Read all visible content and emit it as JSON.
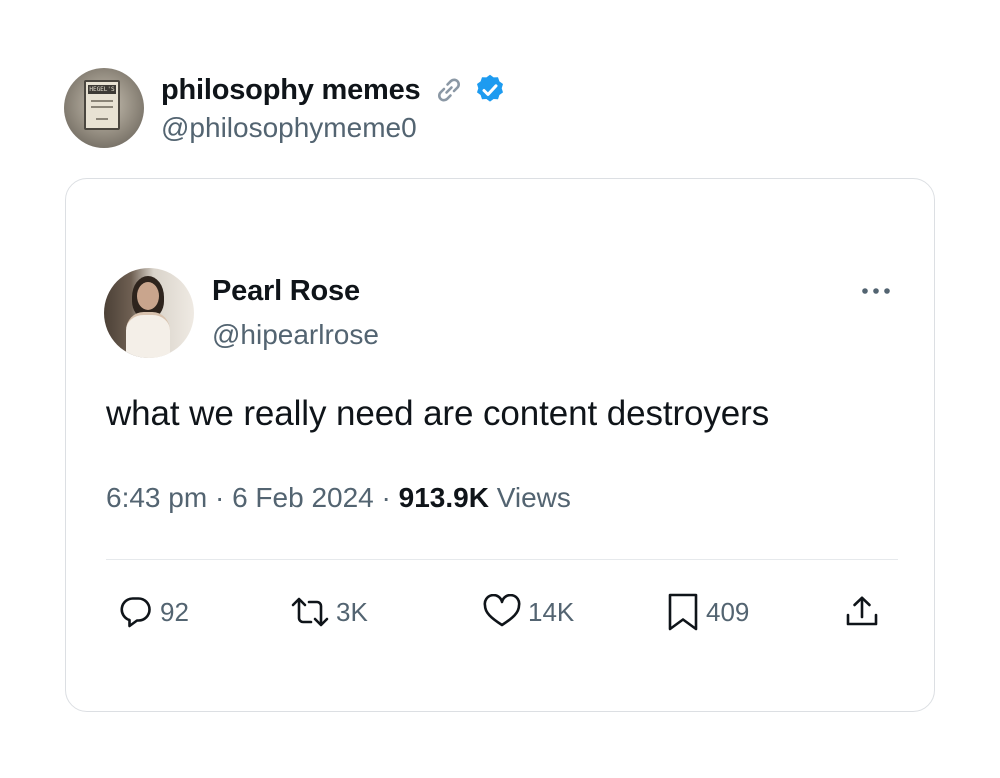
{
  "outer": {
    "display_name": "philosophy memes",
    "handle": "@philosophymeme0",
    "avatar_book_title": "HEGEL'S"
  },
  "tweet": {
    "author_name": "Pearl Rose",
    "author_handle": "@hipearlrose",
    "text": "what we really need are content destroyers",
    "time": "6:43 pm",
    "separator": "·",
    "date": "6 Feb 2024",
    "views_count": "913.9K",
    "views_label": "Views"
  },
  "actions": {
    "replies": "92",
    "reposts": "3K",
    "likes": "14K",
    "bookmarks": "409"
  },
  "colors": {
    "text_primary": "#0f1419",
    "text_secondary": "#536471",
    "verified_blue": "#1d9bf0",
    "card_border": "#dcdfe3"
  },
  "icons": {
    "link": "link-icon",
    "verified": "verified-badge-icon",
    "more": "more-options-icon",
    "reply": "reply-icon",
    "repost": "repost-icon",
    "like": "heart-icon",
    "bookmark": "bookmark-icon",
    "share": "share-icon"
  }
}
